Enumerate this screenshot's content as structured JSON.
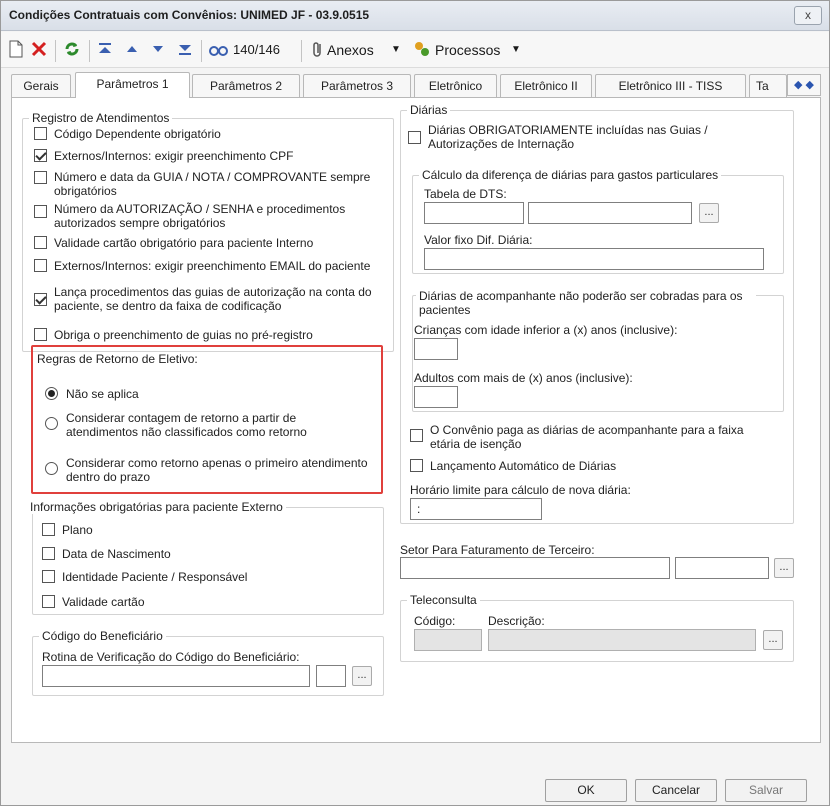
{
  "window": {
    "title": "Condições Contratuais com Convênios: UNIMED JF - 03.9.0515",
    "close_label": "x"
  },
  "toolbar": {
    "record_counter": "140/146",
    "attachments_label": "Anexos",
    "processes_label": "Processos"
  },
  "tabs": [
    {
      "label": "Gerais"
    },
    {
      "label": "Parâmetros 1"
    },
    {
      "label": "Parâmetros 2"
    },
    {
      "label": "Parâmetros 3"
    },
    {
      "label": "Eletrônico"
    },
    {
      "label": "Eletrônico II"
    },
    {
      "label": "Eletrônico III - TISS"
    },
    {
      "label": "Ta"
    }
  ],
  "registro": {
    "legend": "Registro de Atendimentos",
    "items": [
      {
        "label": "Código Dependente obrigatório",
        "checked": false
      },
      {
        "label": "Externos/Internos: exigir preenchimento CPF",
        "checked": true
      },
      {
        "label": "Número e data da GUIA / NOTA / COMPROVANTE sempre obrigatórios",
        "checked": false
      },
      {
        "label": "Número da AUTORIZAÇÃO / SENHA e procedimentos autorizados sempre obrigatórios",
        "checked": false
      },
      {
        "label": "Validade cartão obrigatório para paciente Interno",
        "checked": false
      },
      {
        "label": "Externos/Internos: exigir preenchimento EMAIL do paciente",
        "checked": false
      },
      {
        "label": "Lança procedimentos das guias de autorização na conta do paciente, se dentro da faixa de codificação",
        "checked": true
      },
      {
        "label": "Obriga o preenchimento de guias no pré-registro",
        "checked": false
      }
    ]
  },
  "retorno": {
    "legend": "Regras de Retorno de Eletivo:",
    "options": [
      {
        "label": "Não se aplica",
        "selected": true
      },
      {
        "label": "Considerar contagem de retorno a partir de atendimentos não classificados como retorno",
        "selected": false
      },
      {
        "label": "Considerar como retorno apenas o primeiro atendimento dentro do prazo",
        "selected": false
      }
    ]
  },
  "info_externo": {
    "legend": "Informações obrigatórias para paciente Externo",
    "items": [
      {
        "label": "Plano"
      },
      {
        "label": "Data de Nascimento"
      },
      {
        "label": "Identidade Paciente / Responsável"
      },
      {
        "label": "Validade cartão"
      }
    ]
  },
  "beneficiario": {
    "legend": "Código do Beneficiário",
    "routine_label": "Rotina de Verificação do Código do Beneficiário:",
    "dots": "..."
  },
  "diarias": {
    "legend": "Diárias",
    "obrigatorias_label": "Diárias OBRIGATORIAMENTE incluídas nas Guias / Autorizações de Internação",
    "calculo_legend": "Cálculo da diferença de diárias para gastos particulares",
    "tabela_dts_label": "Tabela de DTS:",
    "valor_fixo_label": "Valor fixo Dif. Diária:",
    "acomp_legend": "Diárias de acompanhante não poderão ser cobradas para os pacientes",
    "criancas_label": "Crianças com idade inferior a (x) anos (inclusive):",
    "adultos_label": "Adultos com mais de (x) anos (inclusive):",
    "convenio_paga_label": "O Convênio paga as diárias de acompanhante para a faixa etária de isenção",
    "lancamento_label": "Lançamento Automático de Diárias",
    "horario_label": "Horário limite para cálculo de nova diária:",
    "horario_value": ":",
    "dots": "..."
  },
  "setor": {
    "label": "Setor Para Faturamento de Terceiro:",
    "dots": "..."
  },
  "teleconsulta": {
    "legend": "Teleconsulta",
    "codigo_label": "Código:",
    "descricao_label": "Descrição:",
    "dots": "..."
  },
  "buttons": {
    "ok": "OK",
    "cancel": "Cancelar",
    "save": "Salvar"
  }
}
